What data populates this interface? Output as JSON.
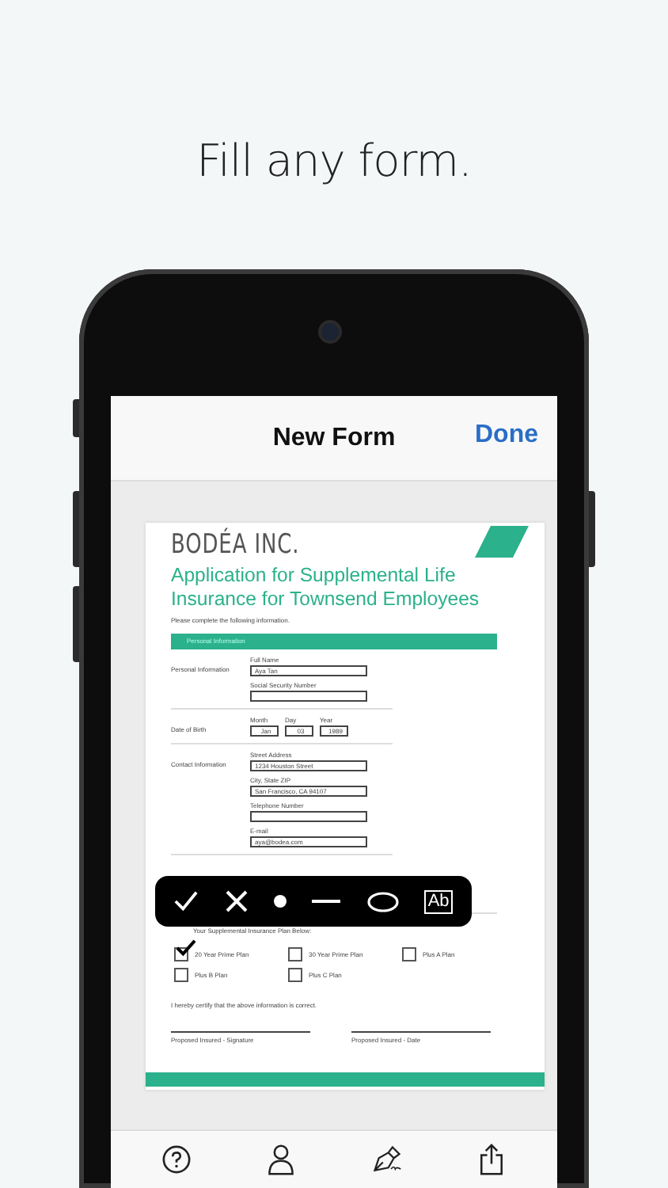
{
  "headline": "Fill any form.",
  "nav": {
    "title": "New Form",
    "done": "Done"
  },
  "form": {
    "company": "BODÉA INC.",
    "title": "Application for Supplemental Life Insurance for Townsend Employees",
    "instruction": "Please complete the following information.",
    "section": "Personal Information",
    "groups": [
      {
        "label": "Personal Information",
        "fields": [
          {
            "label": "Full Name",
            "value": "Aya Tan"
          },
          {
            "label": "Social Security Number"
          }
        ]
      },
      {
        "label": "Date of Birth",
        "date": [
          {
            "label": "Month",
            "value": "Jan"
          },
          {
            "label": "Day",
            "value": "03"
          },
          {
            "label": "Year",
            "value": "1989"
          }
        ]
      },
      {
        "label": "Contact Information",
        "fields": [
          {
            "label": "Street Address",
            "value": "1234 Houston Street"
          },
          {
            "label": "City, State ZIP",
            "value": "San Francisco, CA 94107"
          },
          {
            "label": "Telephone Number"
          },
          {
            "label": "E-mail",
            "value": "aya@bodea.com"
          }
        ]
      }
    ],
    "plan_heading": "Your Supplemental Insurance Plan Below:",
    "plans": [
      {
        "label": "20 Year Prime Plan",
        "checked": true
      },
      {
        "label": "30 Year Prime Plan",
        "checked": false
      },
      {
        "label": "Plus A Plan",
        "checked": false
      },
      {
        "label": "Plus B Plan",
        "checked": false
      },
      {
        "label": "Plus C Plan",
        "checked": false
      }
    ],
    "certify": "I hereby certify that the above information is correct.",
    "signatures": [
      "Proposed Insured - Signature",
      "Proposed Insured - Date"
    ]
  },
  "tools": [
    {
      "kind": "check"
    },
    {
      "kind": "cross"
    },
    {
      "kind": "dot"
    },
    {
      "kind": "line"
    },
    {
      "kind": "ellipse"
    },
    {
      "kind": "text",
      "label": "Ab"
    }
  ]
}
